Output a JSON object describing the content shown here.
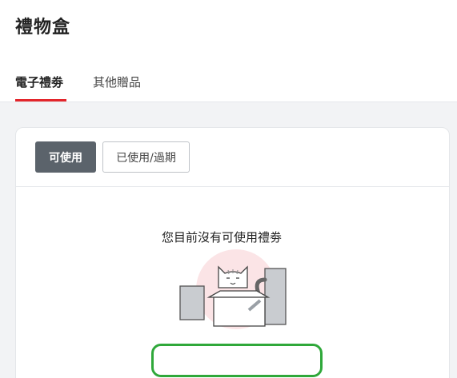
{
  "page": {
    "title": "禮物盒"
  },
  "tabs": [
    {
      "label": "電子禮劵",
      "active": true
    },
    {
      "label": "其他贈品",
      "active": false
    }
  ],
  "filters": {
    "available_label": "可使用",
    "used_expired_label": "已使用/過期",
    "selected": "可使用"
  },
  "empty_state": {
    "message": "您目前沒有可使用禮劵",
    "illustration_icon": "cat-in-box-icon"
  },
  "colors": {
    "accent_red": "#e3252b",
    "active_button": "#5b636b",
    "highlight_green": "#2fa83a"
  }
}
